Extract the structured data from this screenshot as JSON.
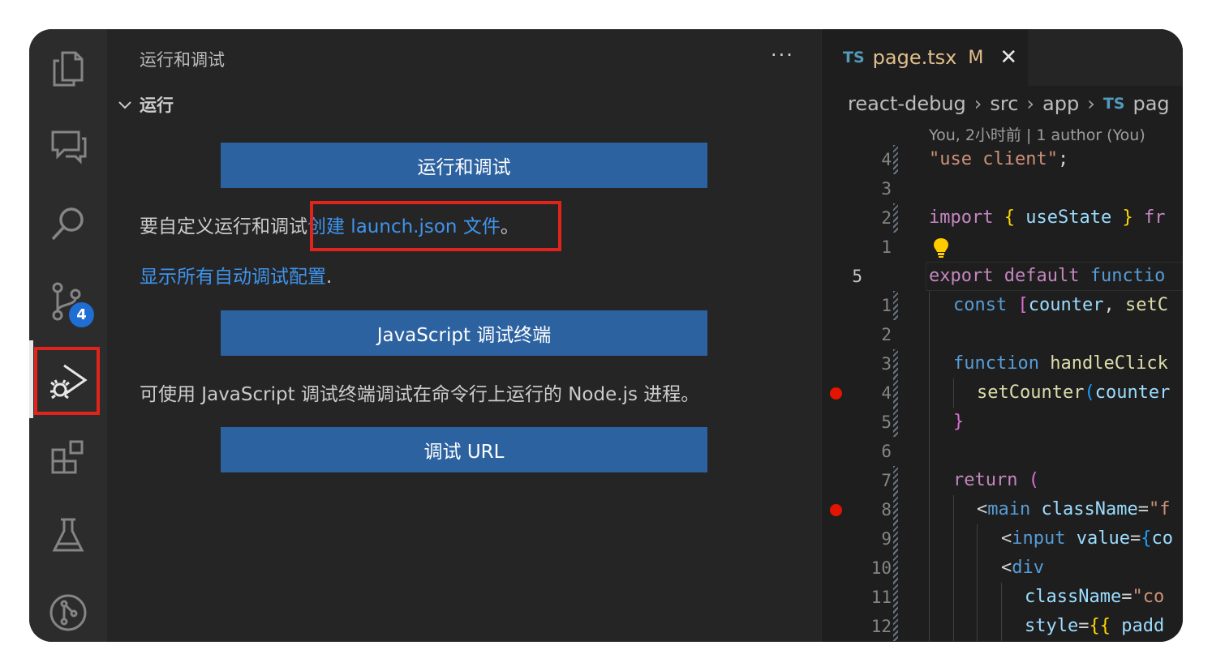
{
  "activity_bar": {
    "items": [
      {
        "name": "explorer-icon"
      },
      {
        "name": "chat-icon"
      },
      {
        "name": "search-icon"
      },
      {
        "name": "source-control-icon",
        "badge": "4"
      },
      {
        "name": "run-debug-icon",
        "active": true
      },
      {
        "name": "extensions-icon"
      },
      {
        "name": "testing-icon"
      },
      {
        "name": "git-graph-icon"
      }
    ]
  },
  "sidebar": {
    "title": "运行和调试",
    "more": "···",
    "section_title": "运行",
    "run_debug_button": "运行和调试",
    "customize_prefix": "要自定义运行和调试",
    "create_launch_link": "创建 launch.json 文件",
    "customize_suffix": "。",
    "show_configs_link": "显示所有自动调试配置",
    "show_configs_suffix": ".",
    "js_terminal_button": "JavaScript 调试终端",
    "js_terminal_desc": "可使用 JavaScript 调试终端调试在命令行上运行的 Node.js 进程。",
    "debug_url_button": "调试 URL"
  },
  "editor": {
    "tab": {
      "lang": "TS",
      "filename": "page.tsx",
      "status": "M",
      "close": "✕"
    },
    "breadcrumb": {
      "parts": [
        "react-debug",
        "src",
        "app"
      ],
      "file_lang": "TS",
      "file": "pag"
    },
    "blame": "You, 2小时前 | 1 author (You)",
    "line_numbers": [
      "4",
      "3",
      "2",
      "1",
      "",
      "5",
      "1",
      "2",
      "3",
      "4",
      "5",
      "6",
      "7",
      "8",
      "9",
      "10",
      "11",
      "12"
    ],
    "code": {
      "l1": [
        "\"use client\"",
        ";"
      ],
      "l3": [
        "import",
        "{",
        "useState",
        "}",
        "fr"
      ],
      "l5": [
        "export",
        "default",
        "functio"
      ],
      "l6": [
        "const",
        "[",
        "counter",
        ",",
        "setC"
      ],
      "l8": [
        "function",
        "handleClick"
      ],
      "l9": [
        "setCounter",
        "(",
        "counter"
      ],
      "l10": [
        "}"
      ],
      "l12": [
        "return",
        "("
      ],
      "l13": [
        "<",
        "main",
        "className",
        "=",
        "\"f"
      ],
      "l14": [
        "<",
        "input",
        "value",
        "=",
        "{",
        "co"
      ],
      "l15": [
        "<",
        "div"
      ],
      "l16": [
        "className",
        "=",
        "\"co"
      ],
      "l17": [
        "style",
        "=",
        "{{",
        "padd"
      ]
    }
  }
}
